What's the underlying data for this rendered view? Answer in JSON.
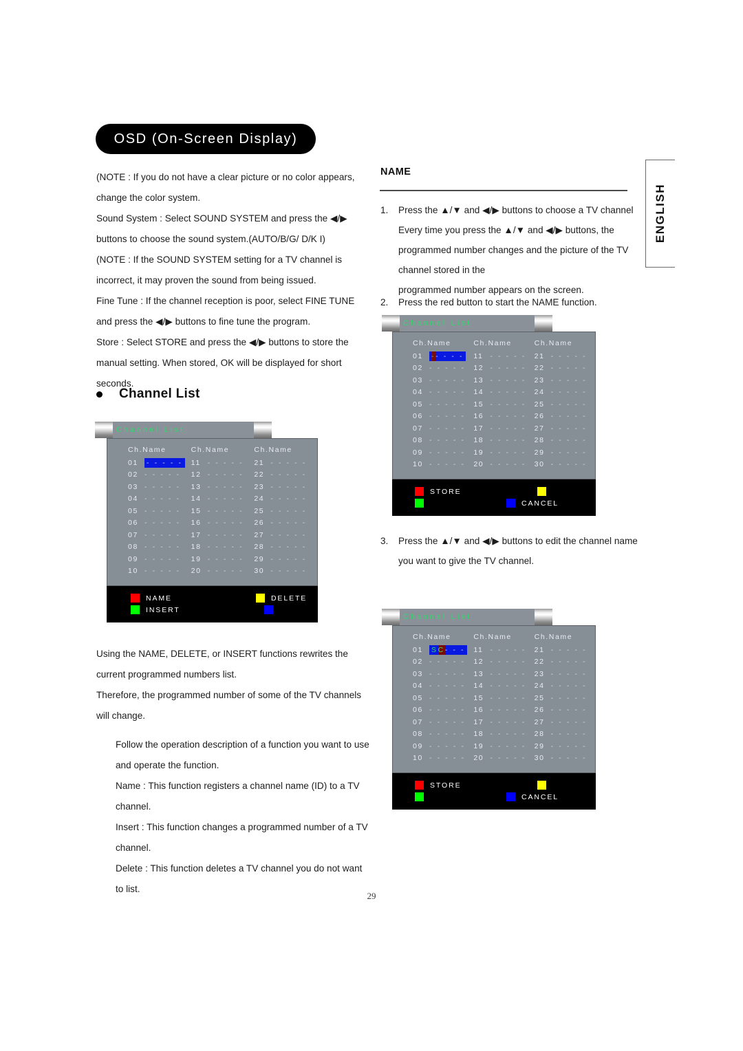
{
  "header": {
    "title": "OSD (On-Screen Display)",
    "language_tab": "ENGLISH"
  },
  "page_number": "29",
  "left_column": {
    "intro_paragraphs": [
      "(NOTE : If you do not have a clear picture or no color appears, change the color system.",
      "Sound System : Select SOUND SYSTEM and press the ◀/▶ buttons to choose the sound system.(AUTO/B/G/ D/K I)",
      "(NOTE : If the SOUND SYSTEM setting for a TV channel is incorrect, it may proven the sound from being issued.",
      "Fine Tune : If the channel reception is poor, select FINE TUNE and press the ◀/▶ buttons to fine tune the program.",
      "Store : Select STORE and press the ◀/▶ buttons to store the manual setting. When stored, OK will be displayed for short seconds."
    ],
    "section_heading": "Channel List",
    "after_paragraphs": [
      "Using the NAME, DELETE, or INSERT functions rewrites the current programmed numbers list.",
      "Therefore, the programmed number of some of the TV channels will change."
    ],
    "indented_paragraphs": [
      "Follow the operation description of a function you want to use and operate the function.",
      "Name : This function registers a channel name (ID) to a TV channel.",
      "Insert : This function changes a programmed number of a TV channel.",
      "Delete : This function deletes a TV channel you do not want to list."
    ]
  },
  "right_column": {
    "heading": "NAME",
    "steps": [
      {
        "number": "1.",
        "lines": [
          "Press the ▲/▼ and ◀/▶ buttons to choose a TV channel",
          "Every time you press the ▲/▼ and ◀/▶ buttons, the",
          "programmed number changes and the picture of the TV",
          "channel stored in the",
          "programmed number appears on the screen."
        ]
      },
      {
        "number": "2.",
        "lines": [
          "Press the red button to start the NAME function."
        ]
      },
      {
        "number": "3.",
        "lines": [
          "Press the ▲/▼ and ◀/▶ buttons to edit the channel name",
          "you want to give the TV channel."
        ]
      }
    ]
  },
  "osd_common": {
    "title": "Channel List",
    "column_header": "Ch.Name",
    "empty_name": "- - - - -",
    "channel_numbers": [
      [
        "01",
        "02",
        "03",
        "04",
        "05",
        "06",
        "07",
        "08",
        "09",
        "10"
      ],
      [
        "11",
        "12",
        "13",
        "14",
        "15",
        "16",
        "17",
        "18",
        "19",
        "20"
      ],
      [
        "21",
        "22",
        "23",
        "24",
        "25",
        "26",
        "27",
        "28",
        "29",
        "30"
      ]
    ]
  },
  "osd_widget_1": {
    "selection": {
      "row": "01",
      "text": "- - - - -",
      "cursor_chars": "",
      "rest_chars": "- - - - -"
    },
    "buttons": [
      {
        "color": "#ff0000",
        "label": "NAME",
        "name": "red-button"
      },
      {
        "color": "#ffff00",
        "label": "DELETE",
        "name": "yellow-button"
      },
      {
        "color": "#00ff00",
        "label": "INSERT",
        "name": "green-button"
      },
      {
        "color": "#0000ff",
        "label": "",
        "name": "blue-button"
      }
    ]
  },
  "osd_widget_2": {
    "selection": {
      "row": "01",
      "cursor_chars": "-",
      "rest_chars": "- - - -"
    },
    "buttons": [
      {
        "color": "#ff0000",
        "label": "STORE",
        "name": "red-button"
      },
      {
        "color": "#ffff00",
        "label": "",
        "name": "yellow-button"
      },
      {
        "color": "#00ff00",
        "label": "",
        "name": "green-button"
      },
      {
        "color": "#0000ff",
        "label": "CANCEL",
        "name": "blue-button"
      }
    ]
  },
  "osd_widget_3": {
    "selection": {
      "row": "01",
      "typed_chars": "S",
      "cursor_chars": "C",
      "rest_chars": "- - -"
    },
    "buttons": [
      {
        "color": "#ff0000",
        "label": "STORE",
        "name": "red-button"
      },
      {
        "color": "#ffff00",
        "label": "",
        "name": "yellow-button"
      },
      {
        "color": "#00ff00",
        "label": "",
        "name": "green-button"
      },
      {
        "color": "#0000ff",
        "label": "CANCEL",
        "name": "blue-button"
      }
    ]
  },
  "colors": {
    "osd_panel": "#868e96",
    "osd_title_text": "#2fd96b",
    "selection_blue": "#0a19e0",
    "cursor_red": "#7a0c0c",
    "cursor_text_green": "#4ce24c"
  }
}
